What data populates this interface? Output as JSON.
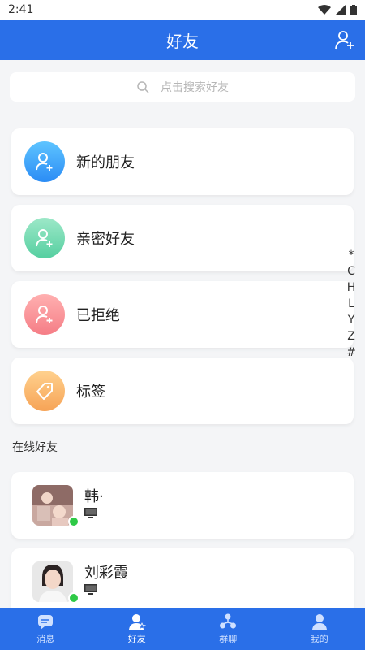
{
  "status": {
    "time": "2:41"
  },
  "header": {
    "title": "好友"
  },
  "search": {
    "placeholder": "点击搜索好友"
  },
  "entries": [
    {
      "label": "新的朋友",
      "icon": "add-user-icon",
      "color_from": "#5ec4ff",
      "color_to": "#2b8cf5"
    },
    {
      "label": "亲密好友",
      "icon": "add-user-icon",
      "color_from": "#9de8c8",
      "color_to": "#55cfa0"
    },
    {
      "label": "已拒绝",
      "icon": "add-user-icon",
      "color_from": "#ffb0b0",
      "color_to": "#f57d86"
    },
    {
      "label": "标签",
      "icon": "tag-icon",
      "color_from": "#ffd18e",
      "color_to": "#f6a356"
    }
  ],
  "index": [
    "*",
    "C",
    "H",
    "L",
    "Y",
    "Z",
    "#"
  ],
  "section": {
    "title": "在线好友"
  },
  "friends": [
    {
      "name": "韩·",
      "status": "online",
      "device": "desktop-icon"
    },
    {
      "name": "刘彩霞",
      "status": "online",
      "device": "desktop-icon"
    }
  ],
  "tabs": [
    {
      "label": "消息",
      "icon": "message-icon"
    },
    {
      "label": "好友",
      "icon": "friends-icon",
      "active": true
    },
    {
      "label": "群聊",
      "icon": "group-icon"
    },
    {
      "label": "我的",
      "icon": "profile-icon"
    }
  ],
  "colors": {
    "brand": "#2a6fe8",
    "online": "#2ec946"
  }
}
